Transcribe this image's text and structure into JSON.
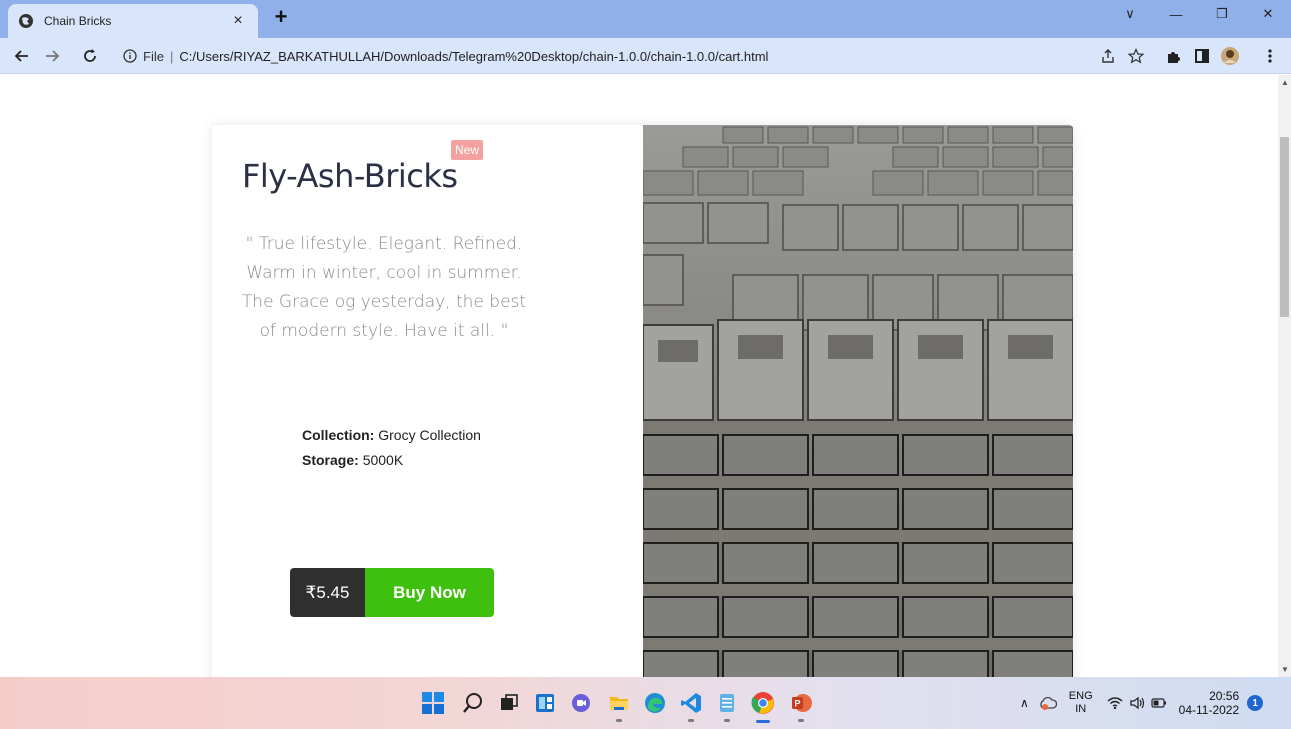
{
  "browser": {
    "tab_title": "Chain Bricks",
    "tab_close": "×",
    "new_tab": "+",
    "address_scheme_label": "File",
    "address_separator": "|",
    "url": "C:/Users/RIYAZ_BARKATHULLAH/Downloads/Telegram%20Desktop/chain-1.0.0/chain-1.0.0/cart.html",
    "window_controls": {
      "dropdown": "∨",
      "minimize": "—",
      "restore": "❐",
      "close": "✕"
    },
    "toolbar_icons": [
      "share-icon",
      "star-icon",
      "extensions-icon",
      "sidepanel-icon",
      "profile-icon",
      "menu-icon"
    ]
  },
  "product": {
    "title": "Fly-Ash-Bricks",
    "badge": "New",
    "quote": "\" True lifestyle. Elegant. Refined. Warm in winter, cool in summer. The Grace og yesterday, the best of modern style. Have it all. \"",
    "collection_label": "Collection:",
    "collection_value": "Grocy Collection",
    "storage_label": "Storage:",
    "storage_value": "5000K",
    "price": "₹5.45",
    "buy_label": "Buy Now",
    "image_subject": "stacked fly ash bricks"
  },
  "taskbar": {
    "apps": [
      "windows-start-icon",
      "search-icon",
      "task-view-icon",
      "widgets-icon",
      "chat-icon",
      "file-explorer-icon",
      "edge-icon",
      "vscode-icon",
      "notepad-icon",
      "chrome-icon",
      "powerpoint-icon"
    ],
    "lang_top": "ENG",
    "lang_bottom": "IN",
    "time": "20:56",
    "date": "04-11-2022",
    "notification_count": "1"
  },
  "colors": {
    "tab_strip": "#8fb0e8",
    "toolbar": "#d8e5fa",
    "buy_button": "#3fc00f",
    "price_box": "#2f2f2f",
    "new_badge": "#f4a1a1",
    "title": "#2b3044"
  }
}
